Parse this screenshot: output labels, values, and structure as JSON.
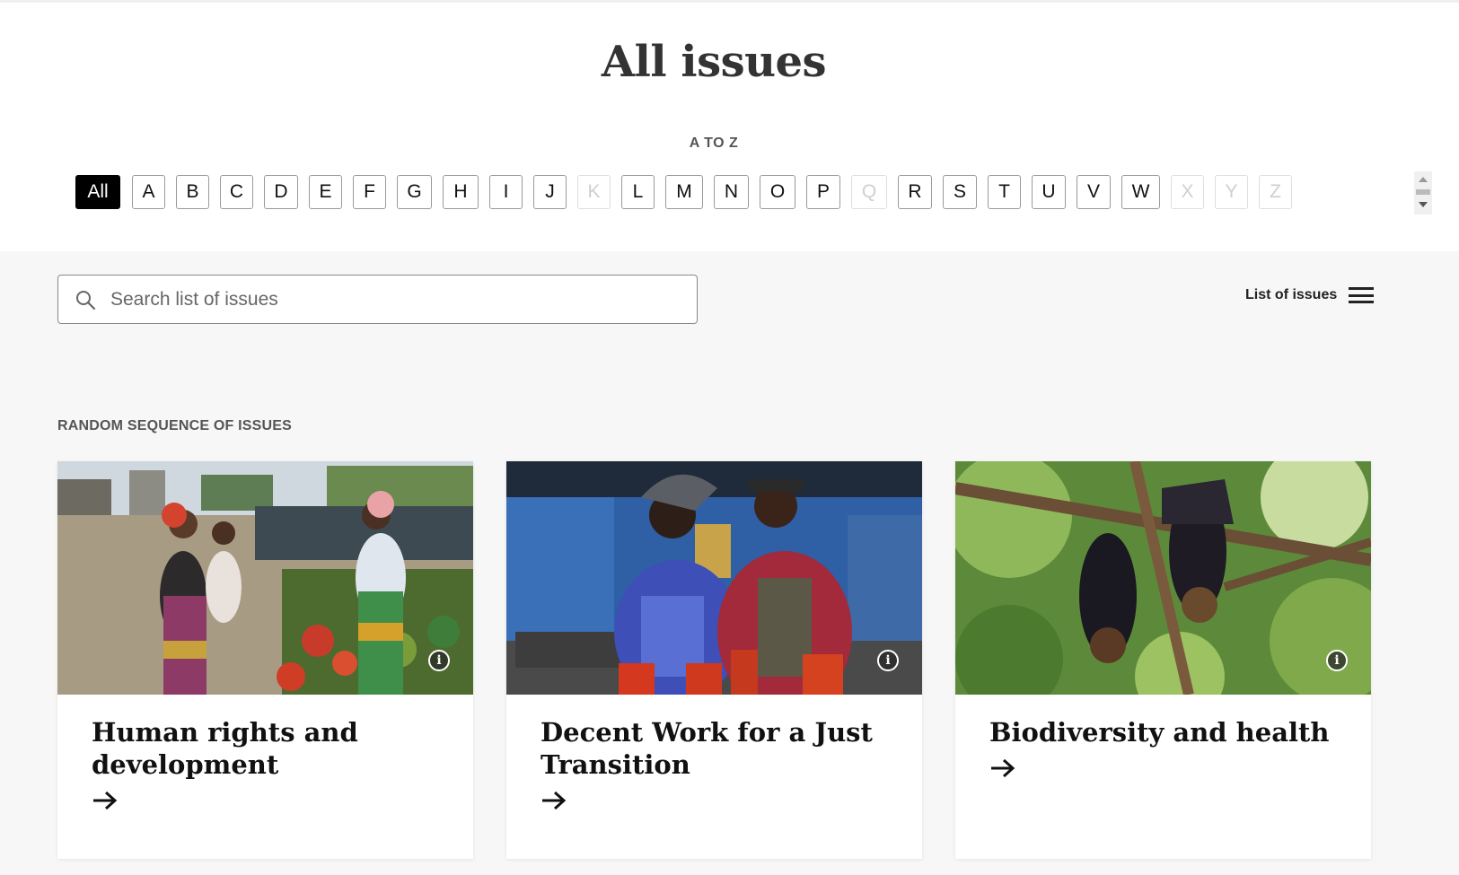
{
  "page": {
    "title": "All issues"
  },
  "atoz": {
    "label": "A TO Z",
    "letters": [
      {
        "label": "All",
        "active": true,
        "enabled": true
      },
      {
        "label": "A",
        "enabled": true
      },
      {
        "label": "B",
        "enabled": true
      },
      {
        "label": "C",
        "enabled": true
      },
      {
        "label": "D",
        "enabled": true
      },
      {
        "label": "E",
        "enabled": true
      },
      {
        "label": "F",
        "enabled": true
      },
      {
        "label": "G",
        "enabled": true
      },
      {
        "label": "H",
        "enabled": true
      },
      {
        "label": "I",
        "enabled": true
      },
      {
        "label": "J",
        "enabled": true
      },
      {
        "label": "K",
        "enabled": false
      },
      {
        "label": "L",
        "enabled": true
      },
      {
        "label": "M",
        "enabled": true
      },
      {
        "label": "N",
        "enabled": true
      },
      {
        "label": "O",
        "enabled": true
      },
      {
        "label": "P",
        "enabled": true
      },
      {
        "label": "Q",
        "enabled": false
      },
      {
        "label": "R",
        "enabled": true
      },
      {
        "label": "S",
        "enabled": true
      },
      {
        "label": "T",
        "enabled": true
      },
      {
        "label": "U",
        "enabled": true
      },
      {
        "label": "V",
        "enabled": true
      },
      {
        "label": "W",
        "enabled": true
      },
      {
        "label": "X",
        "enabled": false
      },
      {
        "label": "Y",
        "enabled": false
      },
      {
        "label": "Z",
        "enabled": false
      }
    ]
  },
  "search": {
    "placeholder": "Search list of issues",
    "value": "",
    "icon": "search-icon"
  },
  "list_toggle": {
    "label": "List of issues",
    "icon": "hamburger-menu-icon"
  },
  "section": {
    "label": "RANDOM SEQUENCE OF ISSUES"
  },
  "cards": [
    {
      "title": "Human rights and development",
      "image": "market-women-photo",
      "icon": "info-icon"
    },
    {
      "title": "Decent Work for a Just Transition",
      "image": "welding-workshop-photo",
      "icon": "info-icon"
    },
    {
      "title": "Biodiversity and health",
      "image": "fruit-bats-tree-photo",
      "icon": "info-icon"
    }
  ],
  "colors": {
    "active_letter_bg": "#000000",
    "disabled_letter": "#cfcfcf",
    "page_bg": "#f7f7f7"
  }
}
